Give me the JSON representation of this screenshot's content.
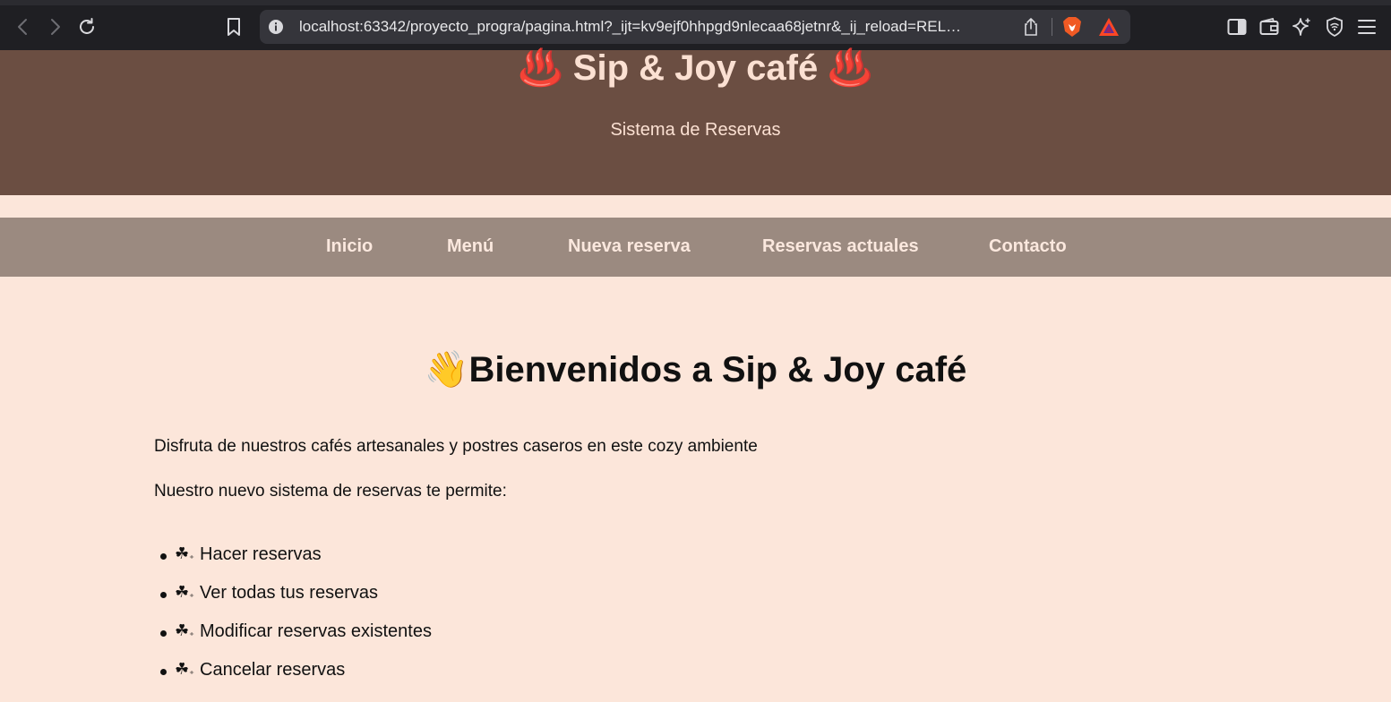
{
  "browser": {
    "url": "localhost:63342/proyecto_progra/pagina.html?_ijt=kv9ejf0hhpgd9nlecaa68jetnr&_ij_reload=REL…"
  },
  "header": {
    "title": "♨️ Sip & Joy café ♨️",
    "subtitle": "Sistema de Reservas"
  },
  "nav": {
    "items": [
      {
        "label": "Inicio"
      },
      {
        "label": "Menú"
      },
      {
        "label": "Nueva reserva"
      },
      {
        "label": "Reservas actuales"
      },
      {
        "label": "Contacto"
      }
    ]
  },
  "main": {
    "heading": "👋Bienvenidos a Sip & Joy café",
    "intro": "Disfruta de nuestros cafés artesanales y postres caseros en este cozy ambiente",
    "features_intro": "Nuestro nuevo sistema de reservas te permite:",
    "feature_icon": "☘︎",
    "features": [
      {
        "label": "Hacer reservas"
      },
      {
        "label": "Ver todas tus reservas"
      },
      {
        "label": "Modificar reservas existentes"
      },
      {
        "label": "Cancelar reservas"
      }
    ]
  },
  "colors": {
    "header_bg": "#6b4e42",
    "nav_bg": "#9b8a80",
    "page_bg": "#fce6da",
    "header_text": "#fbe0d2"
  }
}
